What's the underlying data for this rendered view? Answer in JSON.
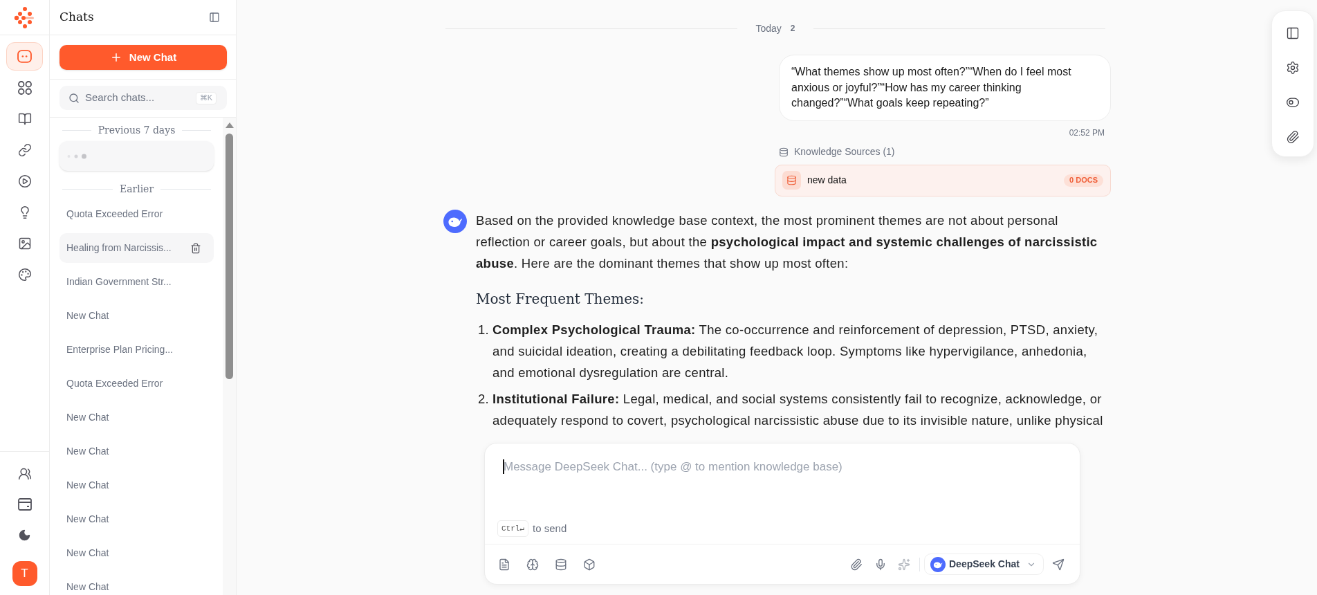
{
  "rail": {
    "nav": [
      {
        "selected": true
      },
      {
        "selected": false
      },
      {
        "selected": false
      },
      {
        "selected": false
      },
      {
        "selected": false
      },
      {
        "selected": false
      },
      {
        "selected": false
      },
      {
        "selected": false
      }
    ],
    "avatar": "T"
  },
  "sidebar": {
    "title": "Chats",
    "new_chat": "New Chat",
    "search": {
      "placeholder": "Search chats...",
      "shortcut": "⌘K"
    },
    "groups": [
      {
        "label": "Previous 7 days",
        "items": [
          {
            "kind": "loading",
            "selected": false
          }
        ]
      },
      {
        "label": "Earlier",
        "items": [
          {
            "kind": "chat",
            "title": "Quota Exceeded Error",
            "selected": false
          },
          {
            "kind": "chat",
            "title": "Healing from Narcissis...",
            "selected": true
          },
          {
            "kind": "chat",
            "title": "Indian Government Str...",
            "selected": false
          },
          {
            "kind": "chat",
            "title": "New Chat",
            "selected": false
          },
          {
            "kind": "chat",
            "title": "Enterprise Plan Pricing...",
            "selected": false
          },
          {
            "kind": "chat",
            "title": "Quota Exceeded Error",
            "selected": false
          },
          {
            "kind": "chat",
            "title": "New Chat",
            "selected": false
          },
          {
            "kind": "chat",
            "title": "New Chat",
            "selected": false
          },
          {
            "kind": "chat",
            "title": "New Chat",
            "selected": false
          },
          {
            "kind": "chat",
            "title": "New Chat",
            "selected": false
          },
          {
            "kind": "chat",
            "title": "New Chat",
            "selected": false
          },
          {
            "kind": "chat",
            "title": "New Chat",
            "selected": false
          }
        ]
      }
    ]
  },
  "main": {
    "date_divider": {
      "label": "Today",
      "count": "2"
    },
    "messages": [
      {
        "kind": "user",
        "text": "“What themes show up most often?”“When do I feel most anxious or joyful?”“How has my career thinking changed?”“What goals keep repeating?”",
        "time": "02:52 PM",
        "sources": {
          "label": "Knowledge Sources (1)",
          "items": [
            {
              "name": "new data",
              "badge": "0 DOCS"
            }
          ]
        }
      },
      {
        "kind": "assistant",
        "blocks": [
          {
            "kind": "paragraph",
            "text": "Based on the provided knowledge base context, the most prominent themes are not about personal reflection or career goals, but about the **psychological impact and systemic challenges of narcissistic abuse**. Here are the dominant themes that show up most often:"
          },
          {
            "kind": "heading",
            "text": "Most Frequent Themes:"
          },
          {
            "kind": "list",
            "items": [
              {
                "marker": "1.",
                "text": "**Complex Psychological Trauma:** The co-occurrence and reinforcement of depression, PTSD, anxiety, and suicidal ideation, creating a debilitating feedback loop. Symptoms like hypervigilance, anhedonia, and emotional dysregulation are central."
              },
              {
                "marker": "2.",
                "text": "**Institutional Failure:** Legal, medical, and social systems consistently fail to recognize, acknowledge, or adequately respond to covert, psychological narcissistic abuse due to its invisible nature, unlike physical"
              }
            ]
          }
        ]
      }
    ]
  },
  "composer": {
    "placeholder": "Message DeepSeek Chat... (type @ to mention knowledge base)",
    "focused": true,
    "shortcut": "Ctrl↵",
    "shortcut_label": "to send",
    "enhance_disabled": true,
    "model": "DeepSeek Chat"
  }
}
